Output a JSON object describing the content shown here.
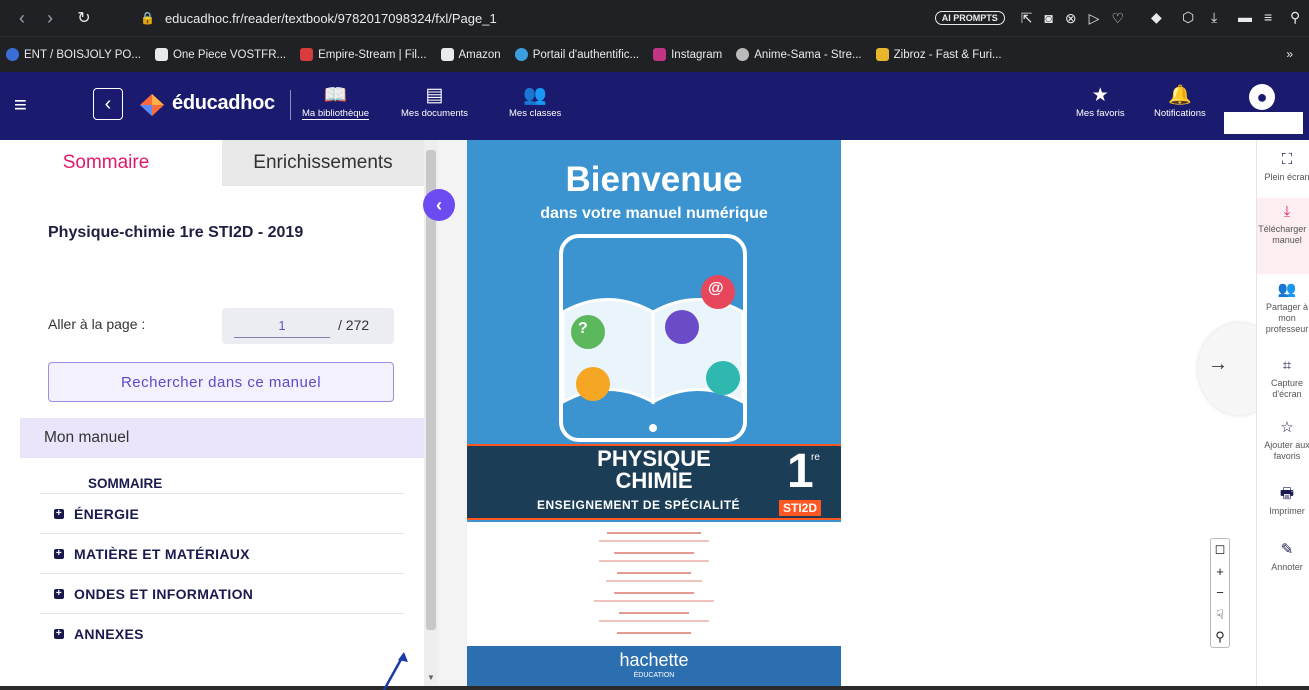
{
  "browser": {
    "url": "educadhoc.fr/reader/textbook/9782017098324/fxl/Page_1",
    "ai_prompts_label": "AI PROMPTS",
    "more_bookmarks": "»",
    "bookmarks": [
      {
        "label": "ENT / BOISJOLY PO...",
        "color": "#3b6fd8"
      },
      {
        "label": "One Piece VOSTFR...",
        "color": "#e8eaed"
      },
      {
        "label": "Empire-Stream | Fil...",
        "color": "#d83b3b"
      },
      {
        "label": "Amazon",
        "color": "#e8eaed"
      },
      {
        "label": "Portail d'authentific...",
        "color": "#3aa0e0"
      },
      {
        "label": "Instagram",
        "color": "#c13584"
      },
      {
        "label": "Anime-Sama - Stre...",
        "color": "#bbbbbb"
      },
      {
        "label": "Zibroz - Fast & Furi...",
        "color": "#e8b62c"
      }
    ]
  },
  "appbar": {
    "logo_text": "éducadhoc",
    "nav": [
      {
        "label": "Ma bibliothèque",
        "icon": "📖"
      },
      {
        "label": "Mes documents",
        "icon": "▤"
      },
      {
        "label": "Mes classes",
        "icon": "👥"
      }
    ],
    "favorites_label": "Mes favoris",
    "notifications_label": "Notifications"
  },
  "sidebar": {
    "tab_sommaire": "Sommaire",
    "tab_enrichissements": "Enrichissements",
    "book_title": "Physique-chimie 1re STI2D - 2019",
    "goto_label": "Aller à la page :",
    "goto_value": "1",
    "goto_total": "/ 272",
    "search_label": "Rechercher dans ce manuel",
    "manuel_label": "Mon manuel",
    "toc_header": "SOMMAIRE",
    "toc_items": [
      "ÉNERGIE",
      "MATIÈRE ET MATÉRIAUX",
      "ONDES ET INFORMATION",
      "ANNEXES"
    ]
  },
  "cover": {
    "welcome": "Bienvenue",
    "subtitle": "dans votre manuel numérique",
    "title_line1": "PHYSIQUE",
    "title_line2": "CHIMIE",
    "grade": "1",
    "grade_suffix": "re",
    "specialty": "ENSEIGNEMENT DE SPÉCIALITÉ",
    "series_badge": "STI2D",
    "publisher": "hachette",
    "publisher_sub": "ÉDUCATION",
    "icon_labels": {
      "question": "?",
      "at": "@"
    }
  },
  "viewer": {
    "next_label": "→"
  },
  "rail": [
    {
      "label": "Plein écran",
      "icon": "⛶",
      "active": false
    },
    {
      "label": "Télécharger le manuel",
      "icon": "⤓",
      "active": true
    },
    {
      "label": "Partager à mon professeur",
      "icon": "👥",
      "active": false
    },
    {
      "label": "Capture d'écran",
      "icon": "⌗",
      "active": false
    },
    {
      "label": "Ajouter aux favoris",
      "icon": "☆",
      "active": false
    },
    {
      "label": "Imprimer",
      "icon": "🖶",
      "active": false
    },
    {
      "label": "Annoter",
      "icon": "✎",
      "active": false
    }
  ],
  "colors": {
    "appbar": "#1a1a6e",
    "accent_pink": "#e0196b",
    "accent_purple": "#6c4cf0",
    "cover_blue": "#3b93cf",
    "cover_orange": "#ff5722"
  }
}
